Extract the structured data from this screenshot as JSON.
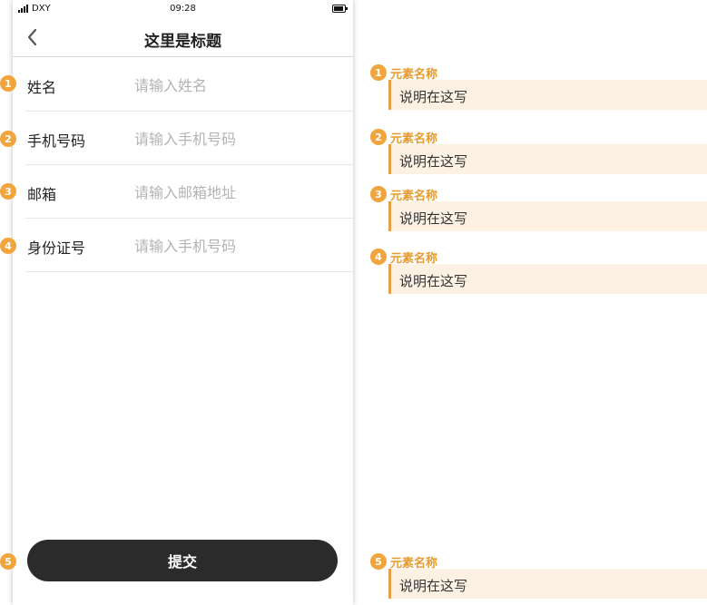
{
  "status_bar": {
    "carrier": "DXY",
    "time": "09:28"
  },
  "nav": {
    "title": "这里是标题"
  },
  "form": {
    "fields": [
      {
        "badge": "1",
        "label": "姓名",
        "placeholder": "请输入姓名"
      },
      {
        "badge": "2",
        "label": "手机号码",
        "placeholder": "请输入手机号码"
      },
      {
        "badge": "3",
        "label": "邮箱",
        "placeholder": "请输入邮箱地址"
      },
      {
        "badge": "4",
        "label": "身份证号",
        "placeholder": "请输入手机号码"
      }
    ]
  },
  "submit": {
    "badge": "5",
    "label": "提交"
  },
  "annotations": [
    {
      "badge": "1",
      "title": "元素名称",
      "text": "说明在这写"
    },
    {
      "badge": "2",
      "title": "元素名称",
      "text": "说明在这写"
    },
    {
      "badge": "3",
      "title": "元素名称",
      "text": "说明在这写"
    },
    {
      "badge": "4",
      "title": "元素名称",
      "text": "说明在这写"
    },
    {
      "badge": "5",
      "title": "元素名称",
      "text": "说明在这写"
    }
  ],
  "colors": {
    "badge": "#f2a53c",
    "note_title": "#e79b2d",
    "note_bg": "#fdf1e4",
    "note_border": "#e7a045",
    "button_bg": "#2b2b2b"
  }
}
